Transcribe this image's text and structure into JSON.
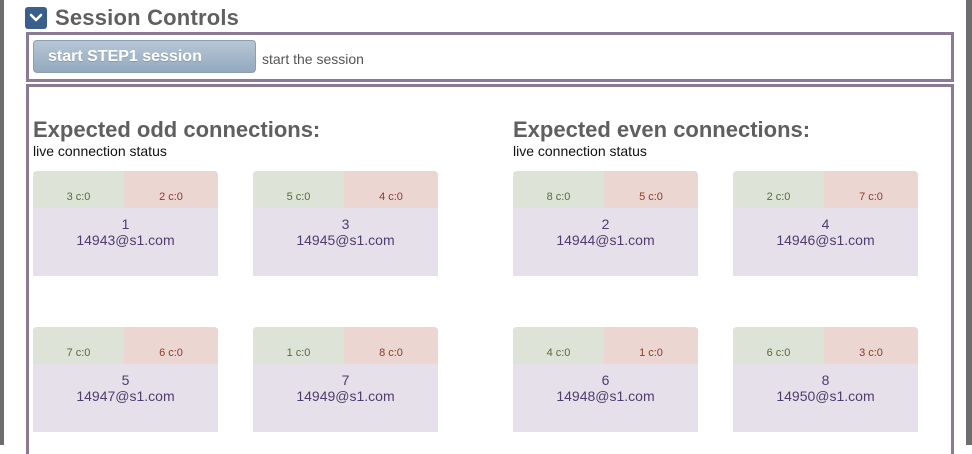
{
  "header": {
    "title": "Session Controls",
    "collapse_icon": "chevron-down-icon"
  },
  "controls": {
    "start_label": "start STEP1 session",
    "start_desc": "start the session"
  },
  "odd": {
    "title": "Expected odd connections:",
    "subtitle": "live connection status",
    "cards": [
      {
        "left": "3 c:0",
        "right": "2 c:0",
        "id": "1",
        "addr": "14943@s1.com"
      },
      {
        "left": "5 c:0",
        "right": "4 c:0",
        "id": "3",
        "addr": "14945@s1.com"
      },
      {
        "left": "7 c:0",
        "right": "6 c:0",
        "id": "5",
        "addr": "14947@s1.com"
      },
      {
        "left": "1 c:0",
        "right": "8 c:0",
        "id": "7",
        "addr": "14949@s1.com"
      }
    ]
  },
  "even": {
    "title": "Expected even connections:",
    "subtitle": "live connection status",
    "cards": [
      {
        "left": "8 c:0",
        "right": "5 c:0",
        "id": "2",
        "addr": "14944@s1.com"
      },
      {
        "left": "2 c:0",
        "right": "7 c:0",
        "id": "4",
        "addr": "14946@s1.com"
      },
      {
        "left": "4 c:0",
        "right": "1 c:0",
        "id": "6",
        "addr": "14948@s1.com"
      },
      {
        "left": "6 c:0",
        "right": "3 c:0",
        "id": "8",
        "addr": "14950@s1.com"
      }
    ]
  },
  "colors": {
    "frame": "#8a7a93",
    "card_bg": "#e6e0ea",
    "cell_green": "#dde3d7",
    "cell_red": "#ebd6d2",
    "button": "#94a9bf"
  }
}
